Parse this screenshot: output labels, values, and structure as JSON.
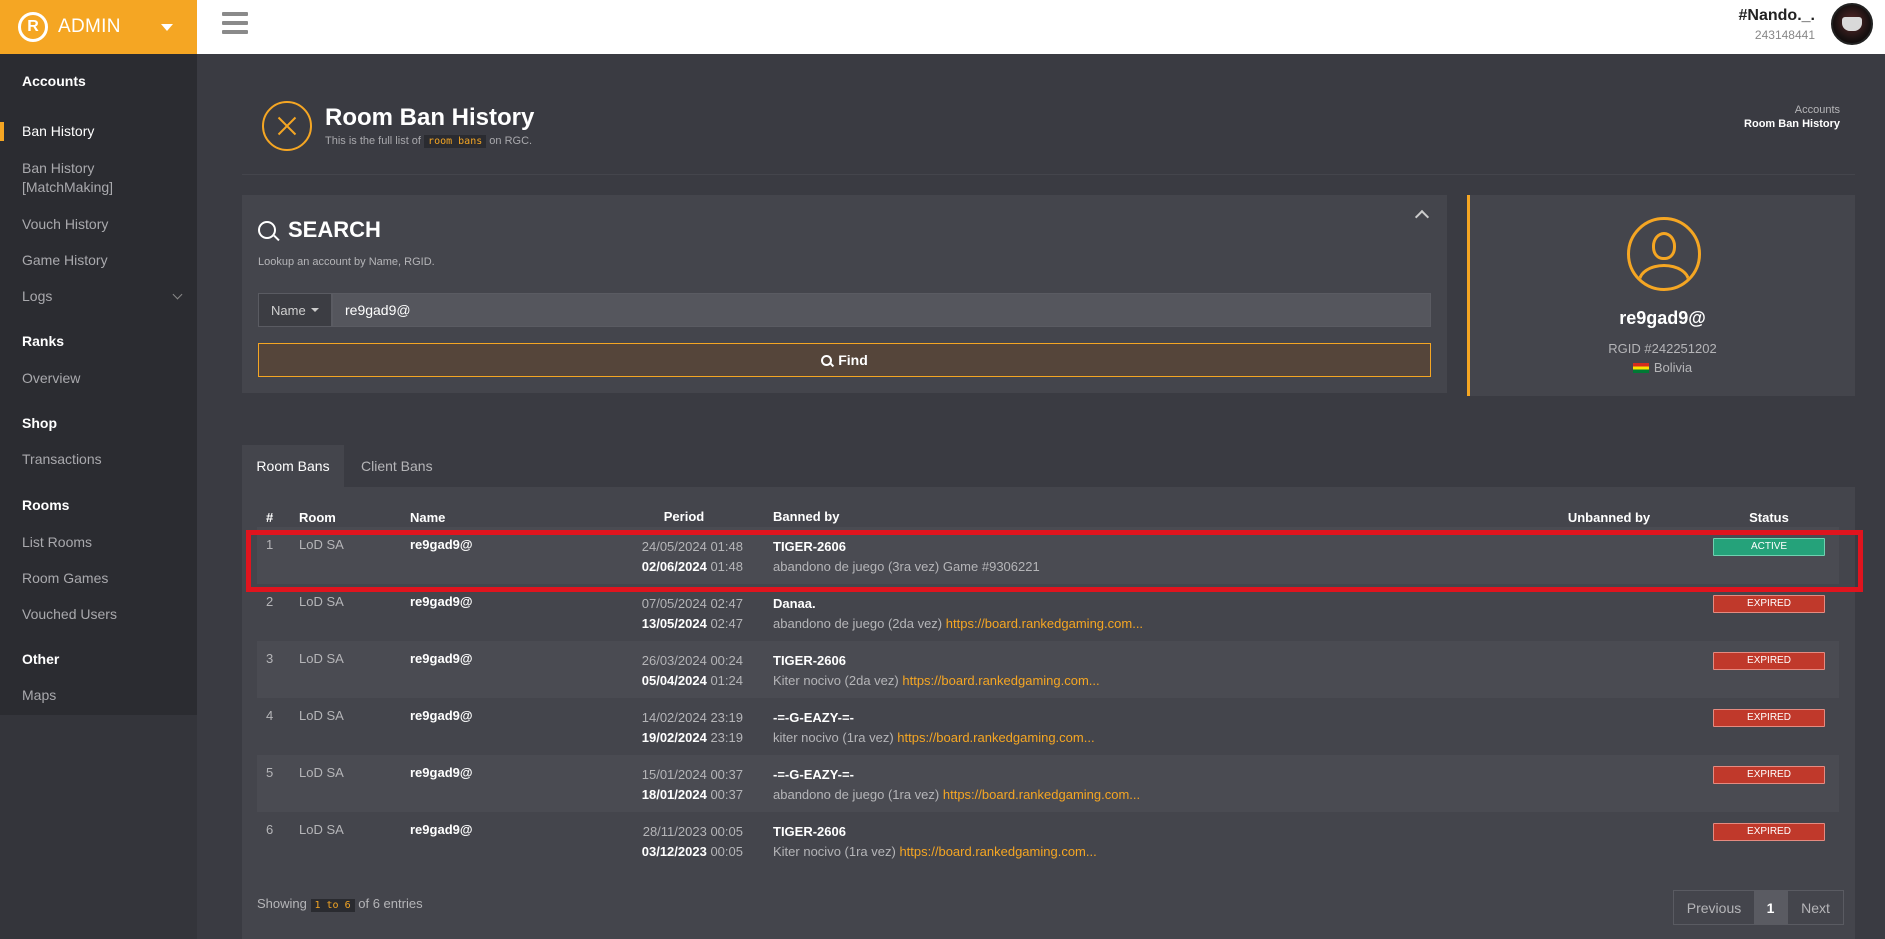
{
  "brand": {
    "logo_letter": "R",
    "label": "ADMIN"
  },
  "user": {
    "name": "#Nando._.",
    "id": "243148441"
  },
  "sidebar": {
    "sections": [
      {
        "title": "Accounts",
        "items": [
          {
            "label": "Ban History",
            "active": true
          },
          {
            "label": "Ban History [MatchMaking]"
          },
          {
            "label": "Vouch History"
          },
          {
            "label": "Game History"
          },
          {
            "label": "Logs",
            "has_chevron": true
          }
        ]
      },
      {
        "title": "Ranks",
        "items": [
          {
            "label": "Overview"
          }
        ]
      },
      {
        "title": "Shop",
        "items": [
          {
            "label": "Transactions"
          }
        ]
      },
      {
        "title": "Rooms",
        "items": [
          {
            "label": "List Rooms"
          },
          {
            "label": "Room Games"
          },
          {
            "label": "Vouched Users"
          }
        ]
      },
      {
        "title": "Other",
        "items": [
          {
            "label": "Maps"
          }
        ]
      }
    ]
  },
  "page": {
    "title": "Room Ban History",
    "subtitle_pre": "This is the full list of",
    "subtitle_code": "room bans",
    "subtitle_post": "on RGC.",
    "breadcrumb": [
      "Accounts",
      "Room Ban History"
    ]
  },
  "search": {
    "title": "SEARCH",
    "hint": "Lookup an account by Name, RGID.",
    "select_value": "Name",
    "input_value": "re9gad9@",
    "find_label": "Find"
  },
  "profile": {
    "name": "re9gad9@",
    "rgid": "RGID #242251202",
    "country": "Bolivia"
  },
  "tabs": [
    {
      "label": "Room Bans",
      "active": true
    },
    {
      "label": "Client Bans"
    }
  ],
  "table": {
    "headers": [
      "#",
      "Room",
      "Name",
      "Period",
      "Banned by",
      "Unbanned by",
      "Status"
    ],
    "rows": [
      {
        "num": "1",
        "room": "LoD SA",
        "name": "re9gad9@",
        "start_date": "24/05/2024",
        "start_time": "01:48",
        "end_date": "02/06/2024",
        "end_time": "01:48",
        "banned_by": "TIGER-2606",
        "reason": "abandono de juego (3ra vez) Game #9306221",
        "link": "",
        "unbanned_by": "",
        "status": "ACTIVE"
      },
      {
        "num": "2",
        "room": "LoD SA",
        "name": "re9gad9@",
        "start_date": "07/05/2024",
        "start_time": "02:47",
        "end_date": "13/05/2024",
        "end_time": "02:47",
        "banned_by": "Danaa.",
        "reason": "abandono de juego (2da vez)",
        "link": "https://board.rankedgaming.com...",
        "unbanned_by": "",
        "status": "EXPIRED"
      },
      {
        "num": "3",
        "room": "LoD SA",
        "name": "re9gad9@",
        "start_date": "26/03/2024",
        "start_time": "00:24",
        "end_date": "05/04/2024",
        "end_time": "01:24",
        "banned_by": "TIGER-2606",
        "reason": "Kiter nocivo (2da vez)",
        "link": "https://board.rankedgaming.com...",
        "unbanned_by": "",
        "status": "EXPIRED"
      },
      {
        "num": "4",
        "room": "LoD SA",
        "name": "re9gad9@",
        "start_date": "14/02/2024",
        "start_time": "23:19",
        "end_date": "19/02/2024",
        "end_time": "23:19",
        "banned_by": "-=-G-EAZY-=-",
        "reason": "kiter nocivo (1ra vez)",
        "link": "https://board.rankedgaming.com...",
        "unbanned_by": "",
        "status": "EXPIRED"
      },
      {
        "num": "5",
        "room": "LoD SA",
        "name": "re9gad9@",
        "start_date": "15/01/2024",
        "start_time": "00:37",
        "end_date": "18/01/2024",
        "end_time": "00:37",
        "banned_by": "-=-G-EAZY-=-",
        "reason": "abandono de juego (1ra vez)",
        "link": "https://board.rankedgaming.com...",
        "unbanned_by": "",
        "status": "EXPIRED"
      },
      {
        "num": "6",
        "room": "LoD SA",
        "name": "re9gad9@",
        "start_date": "28/11/2023",
        "start_time": "00:05",
        "end_date": "03/12/2023",
        "end_time": "00:05",
        "banned_by": "TIGER-2606",
        "reason": "Kiter nocivo (1ra vez)",
        "link": "https://board.rankedgaming.com...",
        "unbanned_by": "",
        "status": "EXPIRED"
      }
    ]
  },
  "footer": {
    "showing_pre": "Showing",
    "showing_code": "1 to 6",
    "showing_post": "of 6 entries",
    "pager": {
      "previous": "Previous",
      "current": "1",
      "next": "Next"
    }
  },
  "colors": {
    "accent": "#f5a623",
    "active": "#25a27a",
    "expired": "#c0392b",
    "highlight": "#e0141e"
  },
  "icons": {
    "brand": "logo-icon",
    "menu": "hamburger-icon",
    "page": "close-circle-icon",
    "search": "search-icon",
    "profile": "user-icon",
    "flag": "bolivia-flag-icon"
  }
}
